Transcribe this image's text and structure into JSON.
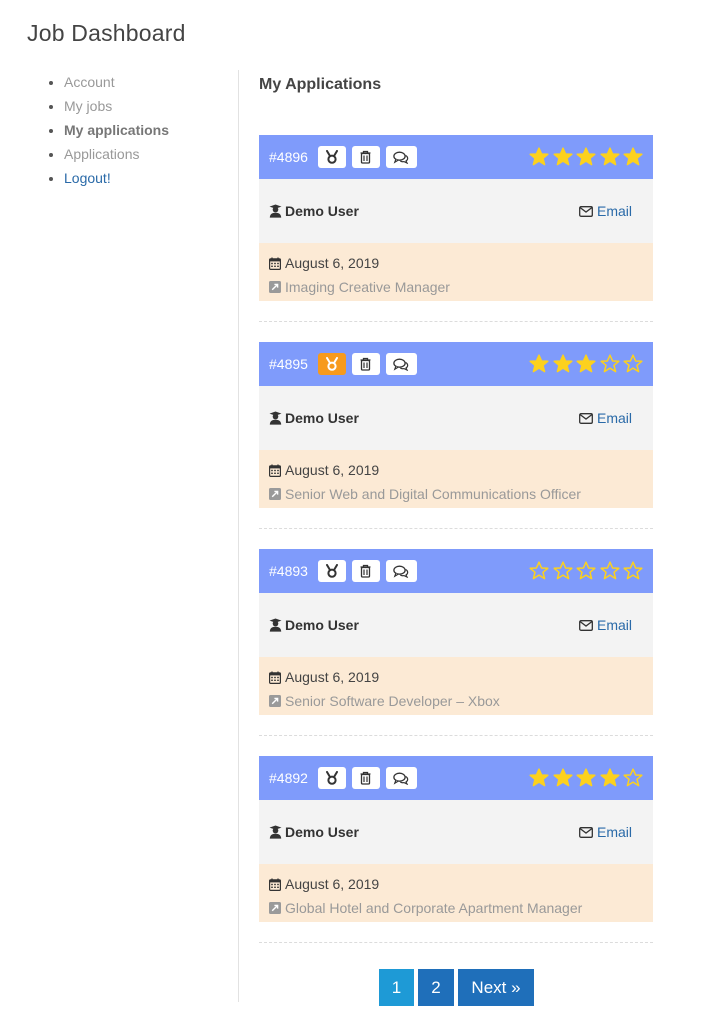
{
  "page": {
    "title": "Job Dashboard"
  },
  "sidebar": {
    "items": [
      {
        "label": "Account"
      },
      {
        "label": "My jobs"
      },
      {
        "label": "My applications"
      },
      {
        "label": "Applications"
      },
      {
        "label": "Logout!"
      }
    ]
  },
  "main": {
    "title": "My Applications",
    "applications": [
      {
        "id": "#4896",
        "featured": false,
        "rating": 5,
        "user": "Demo User",
        "email_label": "Email",
        "date": "August 6, 2019",
        "job": "Imaging Creative Manager"
      },
      {
        "id": "#4895",
        "featured": true,
        "rating": 3,
        "user": "Demo User",
        "email_label": "Email",
        "date": "August 6, 2019",
        "job": "Senior Web and Digital Communications Officer"
      },
      {
        "id": "#4893",
        "featured": false,
        "rating": 0,
        "user": "Demo User",
        "email_label": "Email",
        "date": "August 6, 2019",
        "job": "Senior Software Developer – Xbox"
      },
      {
        "id": "#4892",
        "featured": false,
        "rating": 4,
        "user": "Demo User",
        "email_label": "Email",
        "date": "August 6, 2019",
        "job": "Global Hotel and Corporate Apartment Manager"
      }
    ]
  },
  "pagination": {
    "pages": [
      "1",
      "2"
    ],
    "current": "1",
    "next_label": "Next »"
  },
  "colors": {
    "header_bg": "#7f9bfb",
    "star": "#fcd11e",
    "featured": "#f79a1c",
    "user_bg": "#f3f3f3",
    "info_bg": "#fcead5",
    "link": "#2a6aa8",
    "page_current": "#1e9ad6",
    "page_btn": "#1f6fba"
  },
  "icons": {
    "award": "award-icon",
    "delete": "trash-icon",
    "chat": "chat-icon",
    "user": "user-graduate-icon",
    "email": "envelope-icon",
    "date": "calendar-icon",
    "job": "external-link-icon",
    "star": "star-icon"
  }
}
